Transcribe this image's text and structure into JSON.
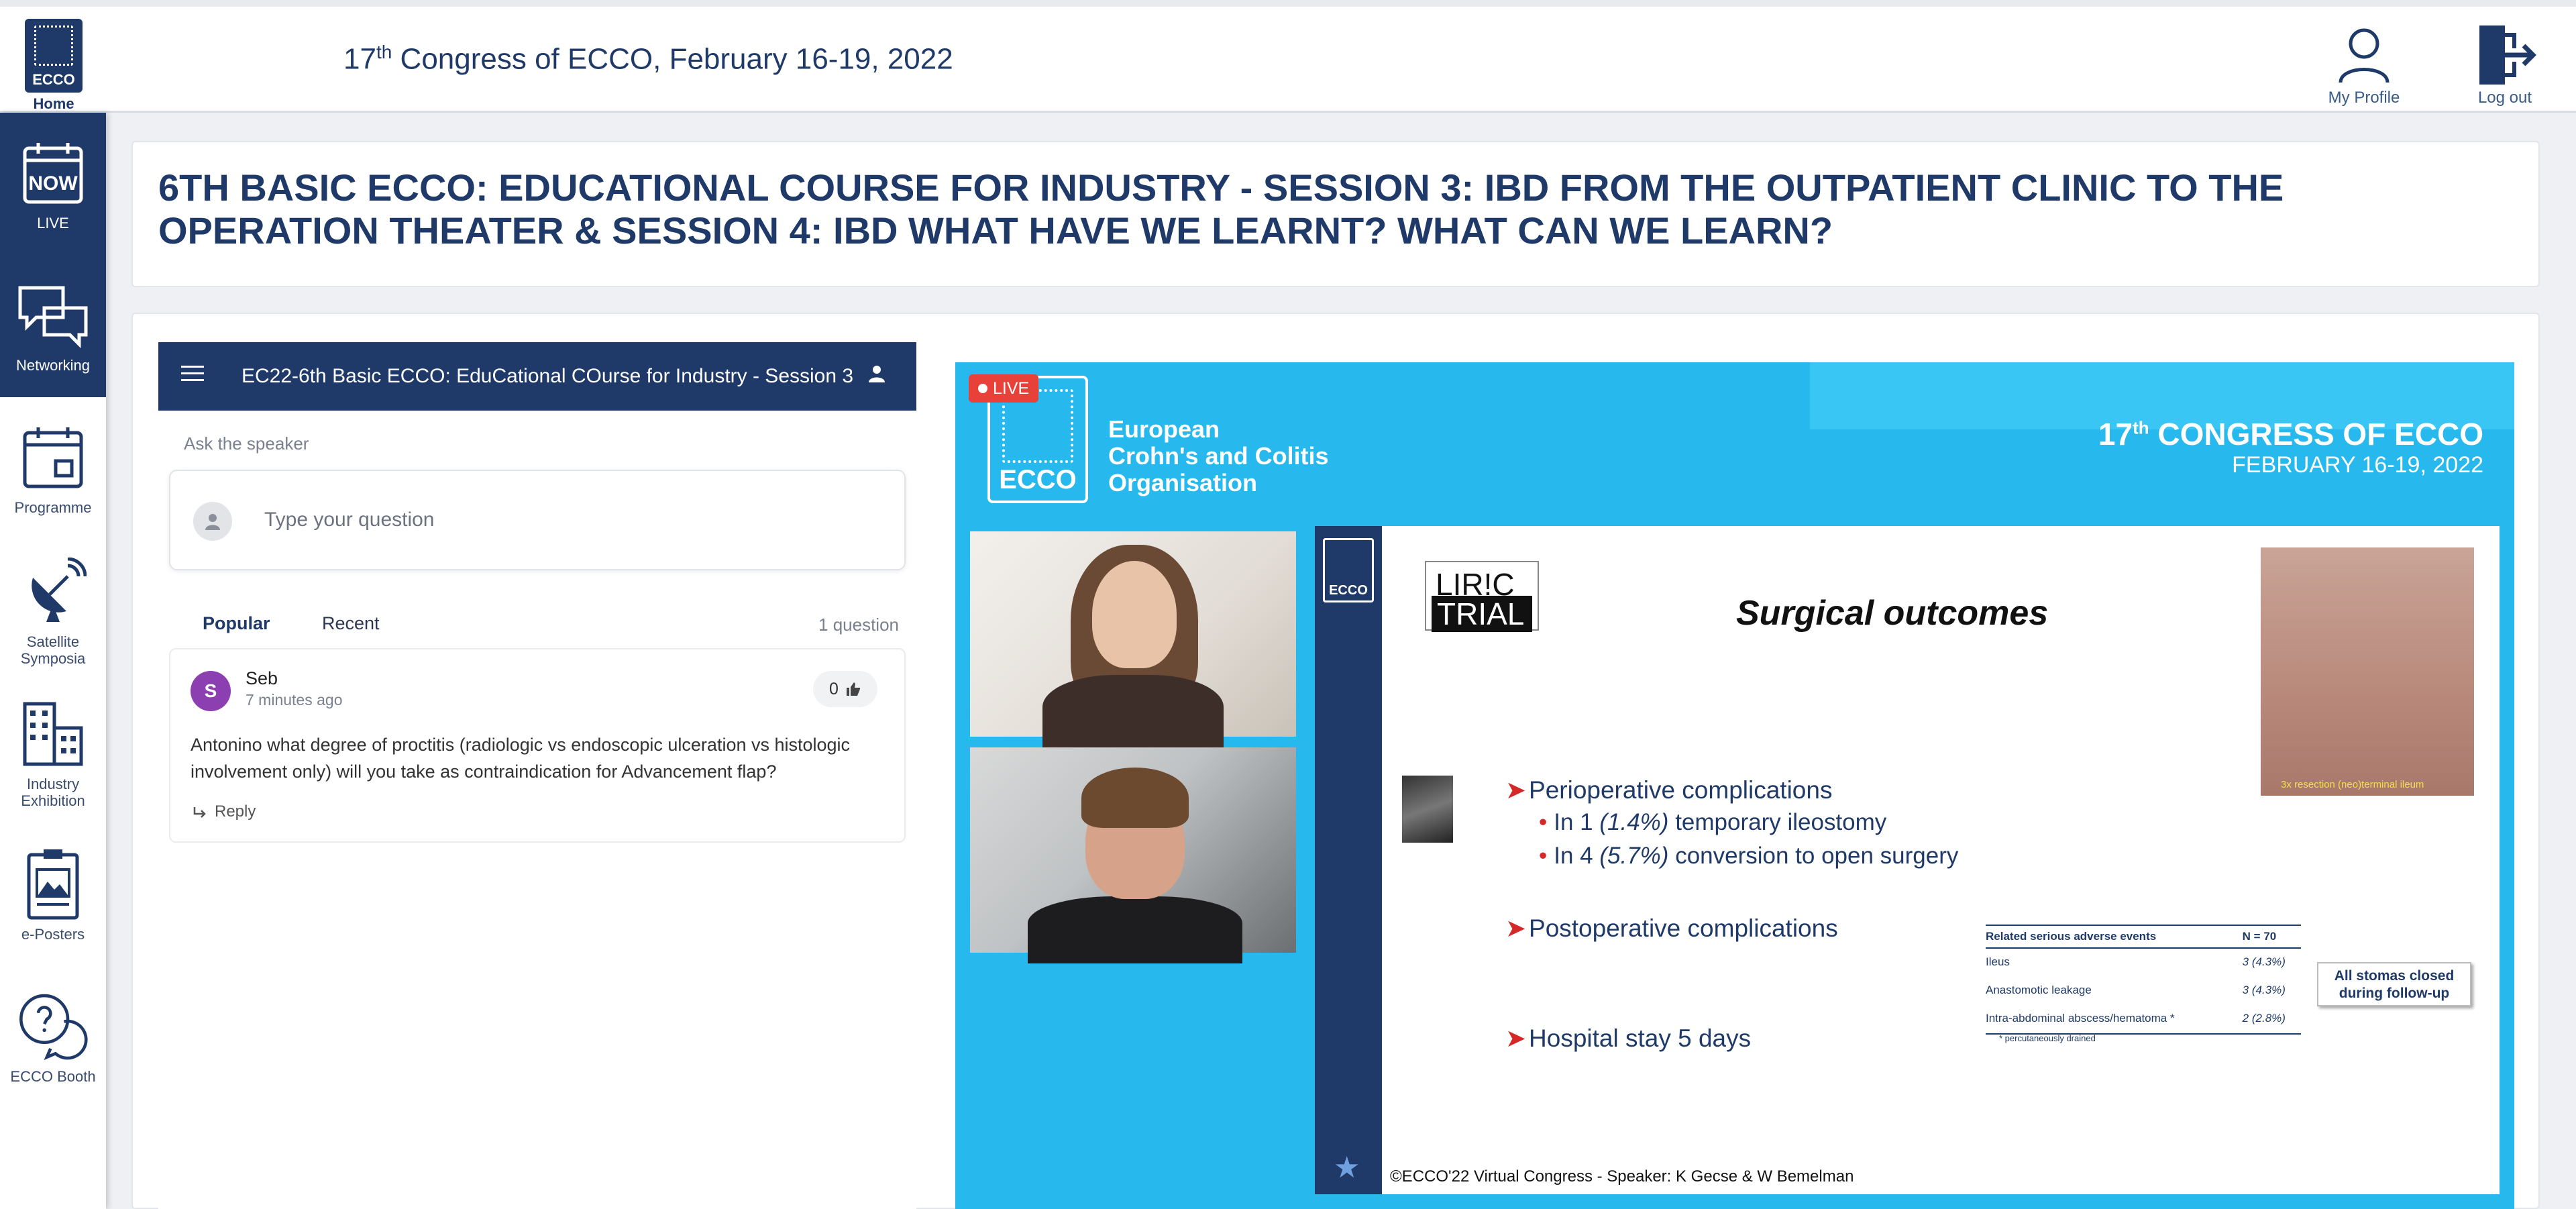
{
  "header": {
    "home_label": "Home",
    "logo_text": "ECCO",
    "congress_title_pre": "17",
    "congress_title_sup": "th",
    "congress_title_post": " Congress of ECCO, February 16-19, 2022",
    "my_profile": "My Profile",
    "log_out": "Log out"
  },
  "sidebar": {
    "items": [
      {
        "label": "LIVE",
        "icon": "now-calendar-icon",
        "badge": "NOW"
      },
      {
        "label": "Networking",
        "icon": "chat-bubbles-icon"
      },
      {
        "label": "Programme",
        "icon": "calendar-icon"
      },
      {
        "label": "Satellite Symposia",
        "icon": "satellite-dish-icon"
      },
      {
        "label": "Industry Exhibition",
        "icon": "buildings-icon"
      },
      {
        "label": "e-Posters",
        "icon": "clipboard-poster-icon"
      },
      {
        "label": "ECCO Booth",
        "icon": "help-chat-icon"
      }
    ]
  },
  "session": {
    "title": "6TH BASIC ECCO: EDUCATIONAL COURSE FOR INDUSTRY - SESSION 3: IBD FROM THE OUTPATIENT CLINIC TO THE OPERATION THEATER & SESSION 4: IBD WHAT HAVE WE LEARNT? WHAT CAN WE LEARN?"
  },
  "qa": {
    "header_title": "EC22-6th Basic ECCO: EduCational COurse for Industry - Session 3: ...",
    "ask_label": "Ask the speaker",
    "input_placeholder": "Type your question",
    "tabs": [
      {
        "label": "Popular"
      },
      {
        "label": "Recent"
      }
    ],
    "question_count": "1 question",
    "question": {
      "avatar_initial": "S",
      "author": "Seb",
      "time": "7 minutes ago",
      "votes": "0",
      "text": "Antonino what degree of proctitis (radiologic vs endoscopic ulceration vs histologic involvement only) will you take as contraindication for Advancement flap?",
      "reply_label": "Reply"
    }
  },
  "video": {
    "live_label": "LIVE",
    "logo_text": "ECCO",
    "org_line1": "European",
    "org_line2": "Crohn's and Colitis",
    "org_line3": "Organisation",
    "congress_line1_pre": "17",
    "congress_line1_sup": "th",
    "congress_line1_post": " CONGRESS OF ECCO",
    "congress_line2": "FEBRUARY 16-19, 2022",
    "slide": {
      "mini_logo": "ECCO",
      "liric_a": "LIR!C",
      "liric_b": "TRIAL",
      "title": "Surgical outcomes",
      "photo_caption": "3x resection (neo)terminal ileum",
      "b1": "Perioperative complications",
      "b1a_pre": "In 1 ",
      "b1a_em": "(1.4%)",
      "b1a_post": " temporary ileostomy",
      "b1b_pre": "In 4 ",
      "b1b_em": "(5.7%)",
      "b1b_post": " conversion to open surgery",
      "b2": "Postoperative complications",
      "b3": "Hospital stay 5 days",
      "table_head": [
        "Related serious adverse events",
        "N = 70"
      ],
      "table_rows": [
        {
          "event": "Ileus",
          "n": "3 (4.3%)"
        },
        {
          "event": "Anastomotic leakage",
          "n": "3 (4.3%)"
        },
        {
          "event": "Intra-abdominal abscess/hematoma *",
          "n": "2 (2.8%)"
        }
      ],
      "table_foot": "* percutaneously drained",
      "stoma_line1": "All stomas closed",
      "stoma_line2": "during follow-up",
      "footer": "©ECCO'22 Virtual Congress -  Speaker: K Gecse & W Bemelman"
    }
  }
}
